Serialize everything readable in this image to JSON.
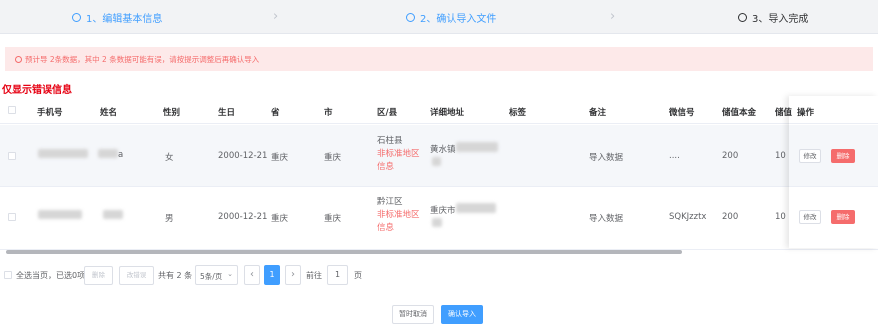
{
  "steps": [
    {
      "label": "1、编辑基本信息"
    },
    {
      "label": "2、确认导入文件"
    },
    {
      "label": "3、导入完成"
    }
  ],
  "alert": {
    "text": "预计导 2条数据，其中 2 条数据可能有误，请按提示调整后再确认导入"
  },
  "error_title": "仅显示错误信息",
  "table": {
    "headers": {
      "phone": "手机号",
      "name": "姓名",
      "gender": "性别",
      "birthday": "生日",
      "province": "省",
      "city": "市",
      "district": "区/县",
      "address": "详细地址",
      "tags": "标签",
      "remark": "备注",
      "wechat": "微信号",
      "principal": "储值本金",
      "gift": "储值",
      "actions": "操作"
    },
    "rows": [
      {
        "name_tail": "a",
        "gender": "女",
        "birthday": "2000-12-21",
        "province": "重庆",
        "city": "重庆",
        "district": "石柱县",
        "warn1": "非标准地区",
        "warn2": "信息",
        "address": "黄水镇",
        "remark": "导入数据",
        "wechat": "....",
        "principal": "200",
        "gift": "10",
        "edit": "修改",
        "delete": "删除"
      },
      {
        "name_tail": "",
        "gender": "男",
        "birthday": "2000-12-21",
        "province": "重庆",
        "city": "重庆",
        "district": "黔江区",
        "warn1": "非标准地区",
        "warn2": "信息",
        "address": "重庆市",
        "remark": "导入数据",
        "wechat": "SQKJzztx",
        "principal": "200",
        "gift": "10",
        "edit": "修改",
        "delete": "删除"
      }
    ]
  },
  "pagination": {
    "select_page_text": "全选当页，已选0项",
    "delete_btn": "删除",
    "modify_btn": "改错误",
    "total": "共有 2 条",
    "page_size": "5条/页",
    "current_page": "1",
    "goto_label": "前往",
    "goto_value": "1",
    "page_suffix": "页"
  },
  "footer": {
    "cancel": "暂时取消",
    "confirm": "确认导入"
  },
  "colors": {
    "primary": "#409eff",
    "danger": "#f56c6c",
    "error_title": "#e60012",
    "alert_bg": "#fde9e9"
  }
}
